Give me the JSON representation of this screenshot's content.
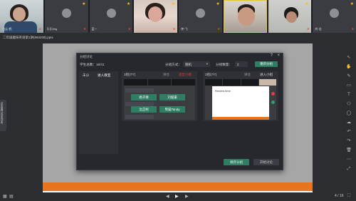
{
  "participants": [
    {
      "name": "白云·鹤",
      "type": "camera"
    },
    {
      "name": "乐乐ting",
      "type": "avatar"
    },
    {
      "name": "蓝一",
      "type": "avatar"
    },
    {
      "name": "",
      "type": "camera"
    },
    {
      "name": "李*飞",
      "type": "avatar"
    },
    {
      "name": "",
      "type": "camera"
    },
    {
      "name": "",
      "type": "camera"
    },
    {
      "name": "刘·佳",
      "type": "avatar"
    }
  ],
  "file_tab": "二年级趣味英语第1讲(950208).pptx",
  "left_panel_label": "点击展开成员列表",
  "dialog": {
    "title": "分组讨论",
    "student_count_label": "学生总数：16/41",
    "mode_label": "分组方式：",
    "mode_value": "随机",
    "group_count_label": "分组数量：",
    "group_count_value": "2",
    "regroup_button": "重新分组",
    "left_tabs": [
      "未分",
      "进入教室"
    ],
    "group1": {
      "title": "1组(7/7)",
      "discuss": "讲台",
      "enter": "退出小组",
      "students": [
        "杨子倩",
        "刘俊豪",
        "沈芷熙",
        "熊猫Tandy"
      ]
    },
    "group2": {
      "title": "2组(7/7)",
      "discuss": "讲台",
      "enter": "进入小组",
      "slide_text": "Review time"
    },
    "save_button": "保存分组",
    "start_button": "开始讨论"
  },
  "pager": "4 / 16",
  "icons": {
    "right_toolbar": [
      "pointer-icon",
      "hand-icon",
      "pen-icon",
      "eraser-icon",
      "text-icon",
      "shape-icon",
      "laser-icon",
      "cloud-icon",
      "undo-icon",
      "redo-icon",
      "trash-icon",
      "more-icon",
      "expand-icon"
    ]
  }
}
